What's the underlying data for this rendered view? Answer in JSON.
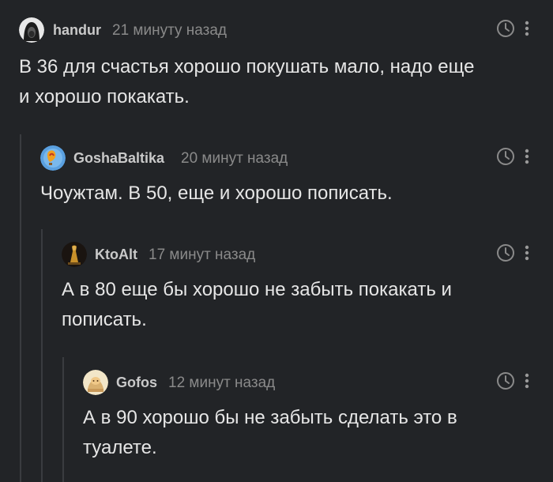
{
  "comments": [
    {
      "author": "handur",
      "time": "21 минуту назад",
      "text": "В 36 для счастья хорошо покушать мало, надо еще\nи хорошо покакать.",
      "avatar_icon": "hooded-person-avatar"
    },
    {
      "author": "GoshaBaltika",
      "time": "20 минут назад",
      "text": "Чоужтам. В 50, еще и хорошо пописать.",
      "avatar_icon": "hot-air-balloon-avatar"
    },
    {
      "author": "KtoAlt",
      "time": "17 минут назад",
      "text": "А в 80 еще бы хорошо не забыть покакать и\nпописать.",
      "avatar_icon": "statue-avatar"
    },
    {
      "author": "Gofos",
      "time": "12 минут назад",
      "text": "А в 90 хорошо бы не забыть сделать это в\nтуалете.",
      "avatar_icon": "cartoon-avatar"
    }
  ],
  "colors": {
    "background": "#222427",
    "text": "#e6e6e6",
    "author": "#c9c9c9",
    "time": "#8a8a8a",
    "branch_line": "#3a3c40",
    "icon": "#8a8a8a"
  }
}
